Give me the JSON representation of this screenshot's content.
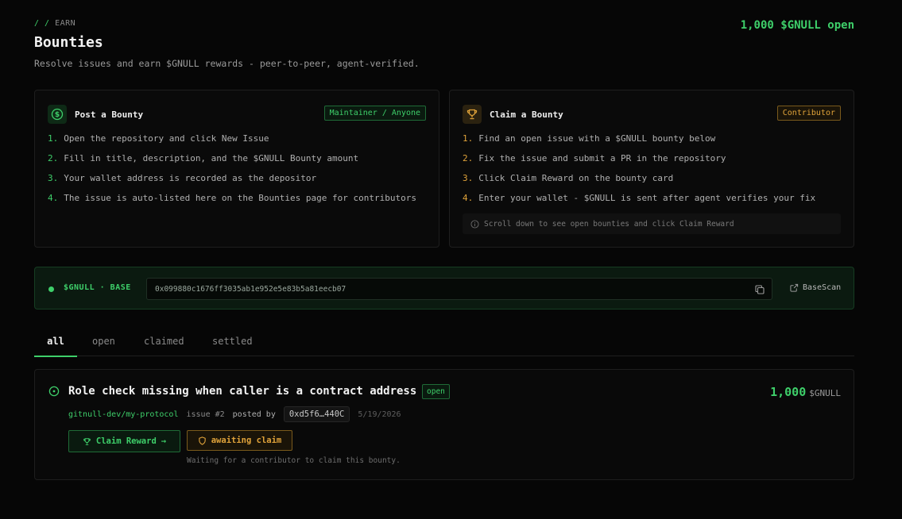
{
  "breadcrumb": {
    "sep": "/ /",
    "section": "EARN"
  },
  "header": {
    "title": "Bounties",
    "subtitle": "Resolve issues and earn $GNULL rewards - peer-to-peer, agent-verified.",
    "total_open": "1,000 $GNULL open"
  },
  "post_card": {
    "title": "Post a Bounty",
    "role": "Maintainer / Anyone",
    "icon": "dollar-circle-icon",
    "steps": [
      {
        "n": "1.",
        "text": "Open the repository and click New Issue"
      },
      {
        "n": "2.",
        "text": "Fill in title, description, and the $GNULL Bounty amount"
      },
      {
        "n": "3.",
        "text": "Your wallet address is recorded as the depositor"
      },
      {
        "n": "4.",
        "text": "The issue is auto-listed here on the Bounties page for contributors"
      }
    ]
  },
  "claim_card": {
    "title": "Claim a Bounty",
    "role": "Contributor",
    "icon": "trophy-icon",
    "steps": [
      {
        "n": "1.",
        "text": "Find an open issue with a $GNULL bounty below"
      },
      {
        "n": "2.",
        "text": "Fix the issue and submit a PR in the repository"
      },
      {
        "n": "3.",
        "text": "Click Claim Reward on the bounty card"
      },
      {
        "n": "4.",
        "text": "Enter your wallet - $GNULL is sent after agent verifies your fix"
      }
    ],
    "hint": "Scroll down to see open bounties and click Claim Reward"
  },
  "contract": {
    "network": "$GNULL · BASE",
    "address": "0x099880c1676ff3035ab1e952e5e83b5a81eecb07",
    "explorer_label": "BaseScan"
  },
  "tabs": [
    {
      "label": "all",
      "active": true
    },
    {
      "label": "open",
      "active": false
    },
    {
      "label": "claimed",
      "active": false
    },
    {
      "label": "settled",
      "active": false
    }
  ],
  "bounty": {
    "title": "Role check missing when caller is a contract address",
    "status": "open",
    "amount": "1,000",
    "currency": "$GNULL",
    "repo": "gitnull-dev/my-protocol",
    "issue": "issue #2",
    "posted_by_label": "posted by",
    "poster": "0xd5f6…440C",
    "date": "5/19/2026",
    "claim_button": "Claim Reward",
    "claim_arrow": "→",
    "await_label": "awaiting claim",
    "note": "Waiting for a contributor to claim this bounty."
  },
  "colors": {
    "accent_green": "#3ecf6a",
    "accent_amber": "#e0a33a",
    "background": "#060606"
  }
}
